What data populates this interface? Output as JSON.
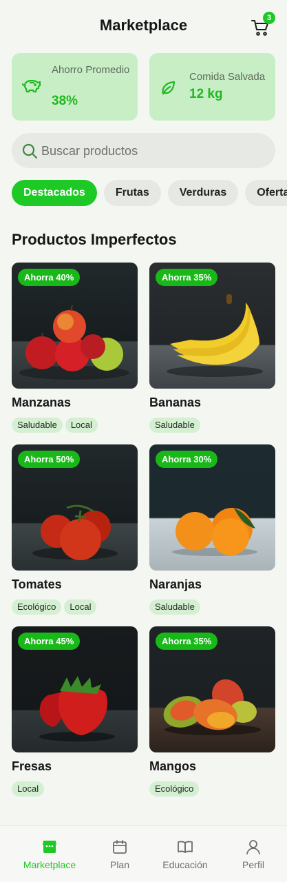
{
  "header": {
    "title": "Marketplace",
    "cart_count": "3"
  },
  "stats": [
    {
      "label": "Ahorro Promedio",
      "value": "38%",
      "icon": "piggy-bank-icon"
    },
    {
      "label": "Comida Salvada",
      "value": "12 kg",
      "icon": "leaf-icon"
    }
  ],
  "search": {
    "placeholder": "Buscar productos",
    "value": ""
  },
  "chips": [
    "Destacados",
    "Frutas",
    "Verduras",
    "Ofertas"
  ],
  "active_chip": "Destacados",
  "section_title": "Productos Imperfectos",
  "products": [
    {
      "name": "Manzanas",
      "discount": "Ahorra 40%",
      "tags": [
        "Saludable",
        "Local"
      ]
    },
    {
      "name": "Bananas",
      "discount": "Ahorra 35%",
      "tags": [
        "Saludable"
      ]
    },
    {
      "name": "Tomates",
      "discount": "Ahorra 50%",
      "tags": [
        "Ecológico",
        "Local"
      ]
    },
    {
      "name": "Naranjas",
      "discount": "Ahorra 30%",
      "tags": [
        "Saludable"
      ]
    },
    {
      "name": "Fresas",
      "discount": "Ahorra 45%",
      "tags": [
        "Local"
      ]
    },
    {
      "name": "Mangos",
      "discount": "Ahorra 35%",
      "tags": [
        "Ecológico"
      ]
    }
  ],
  "nav": [
    {
      "label": "Marketplace",
      "icon": "store-icon",
      "active": true
    },
    {
      "label": "Plan",
      "icon": "calendar-icon",
      "active": false
    },
    {
      "label": "Educación",
      "icon": "book-icon",
      "active": false
    },
    {
      "label": "Perfil",
      "icon": "user-icon",
      "active": false
    }
  ],
  "colors": {
    "accent": "#1dc924",
    "stat_bg": "#c8eec5",
    "tag_bg": "#d4efd2",
    "page_bg": "#f4f6f2"
  }
}
